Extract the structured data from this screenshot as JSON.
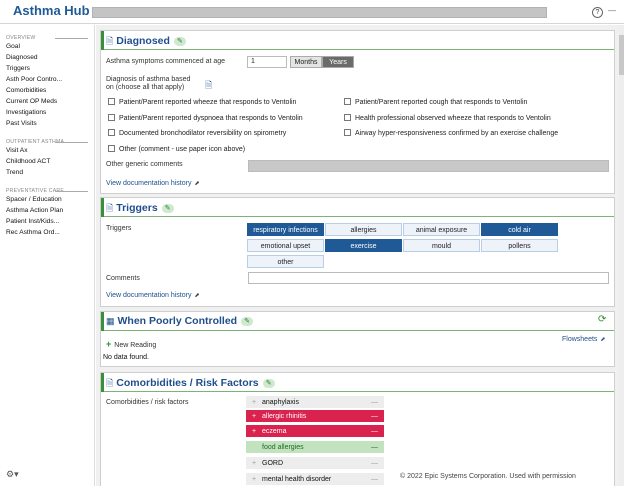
{
  "app": {
    "title": "Asthma Hub -",
    "help": "?"
  },
  "sidebar": {
    "groups": [
      {
        "heading": "Overview",
        "items": [
          "Goal",
          "Diagnosed",
          "Triggers",
          "Asth Poor Contro...",
          "Comorbidities",
          "Current OP Meds",
          "Investigations",
          "Past Visits"
        ]
      },
      {
        "heading": "Outpatient Asthma",
        "items": [
          "Visit Ax",
          "Childhood ACT",
          "Trend"
        ]
      },
      {
        "heading": "Preventative Care",
        "items": [
          "Spacer / Education",
          "Asthma Action Plan",
          "Patient Inst/Kids...",
          "Rec Asthma Ord..."
        ]
      }
    ]
  },
  "diagnosed": {
    "title": "Diagnosed",
    "age_label": "Asthma symptoms commenced at age",
    "age_value": "1",
    "unit_months": "Months",
    "unit_years": "Years",
    "unit_selected": "Years",
    "basis_label_1": "Diagnosis of asthma based",
    "basis_label_2": "on (choose all that apply)",
    "checks": [
      "Patient/Parent reported wheeze that responds to Ventolin",
      "Patient/Parent reported cough that responds to Ventolin",
      "Patient/Parent reported dyspnoea that responds to Ventolin",
      "Health professional observed wheeze that responds to Ventolin",
      "Documented bronchodilator reversibility on spirometry",
      "Airway hyper-responsiveness confirmed by an exercise challenge",
      "Other (comment - use paper icon above)"
    ],
    "other_comments_label": "Other generic comments",
    "history_link": "View documentation history"
  },
  "triggers": {
    "title": "Triggers",
    "label": "Triggers",
    "options": [
      {
        "label": "respiratory infections",
        "selected": true
      },
      {
        "label": "allergies",
        "selected": false
      },
      {
        "label": "animal exposure",
        "selected": false
      },
      {
        "label": "cold air",
        "selected": true
      },
      {
        "label": "emotional upset",
        "selected": false
      },
      {
        "label": "exercise",
        "selected": true
      },
      {
        "label": "mould",
        "selected": false
      },
      {
        "label": "pollens",
        "selected": false
      },
      {
        "label": "other",
        "selected": false
      }
    ],
    "comments_label": "Comments",
    "history_link": "View documentation history"
  },
  "poorly_controlled": {
    "title": "When Poorly Controlled",
    "new_reading": "New Reading",
    "flowsheets": "Flowsheets",
    "empty": "No data found."
  },
  "comorbidities": {
    "title": "Comorbidities / Risk Factors",
    "label": "Comorbidities / risk factors",
    "items": [
      {
        "label": "anaphylaxis",
        "status": "none"
      },
      {
        "label": "allergic rhinitis",
        "status": "positive"
      },
      {
        "label": "eczema",
        "status": "positive"
      },
      {
        "label": "food allergies",
        "status": "negative"
      },
      {
        "label": "GORD",
        "status": "none"
      },
      {
        "label": "mental health disorder",
        "status": "none"
      }
    ]
  },
  "footer": {
    "copyright": "© 2022 Epic Systems Corporation. Used with permission"
  },
  "colors": {
    "brand": "#1f5a96",
    "accent_green": "#3a8f3a",
    "positive": "#d9224e",
    "negative": "#c3e2bf",
    "selected": "#1f5a96"
  }
}
